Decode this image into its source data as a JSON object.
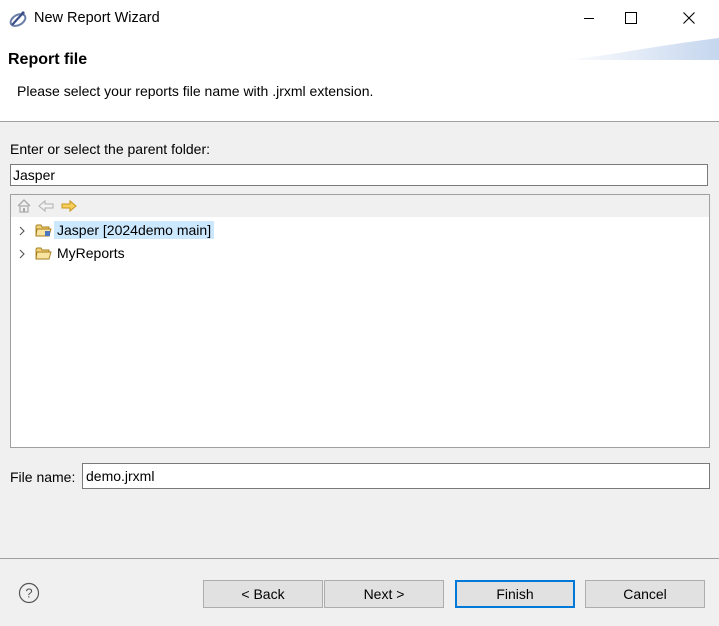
{
  "window": {
    "title": "New Report Wizard",
    "minimize_icon": "minimize-icon",
    "maximize_icon": "maximize-icon",
    "close_icon": "close-icon"
  },
  "header": {
    "title": "Report file",
    "description": "Please select your reports file name with .jrxml extension."
  },
  "parent_folder": {
    "label": "Enter or select the parent folder:",
    "value": "Jasper"
  },
  "tree": {
    "toolbar": [
      "home-icon",
      "back-arrow-icon",
      "forward-arrow-icon"
    ],
    "items": [
      {
        "label": "Jasper [2024demo main]",
        "selected": true
      },
      {
        "label": "MyReports",
        "selected": false
      }
    ]
  },
  "file_name": {
    "label": "File name:",
    "value": "demo.jrxml"
  },
  "buttons": {
    "back": "< Back",
    "next": "Next >",
    "finish": "Finish",
    "cancel": "Cancel"
  },
  "colors": {
    "selection": "#cce8ff",
    "default_button_border": "#0078d7",
    "folder": "#e8b84a"
  }
}
